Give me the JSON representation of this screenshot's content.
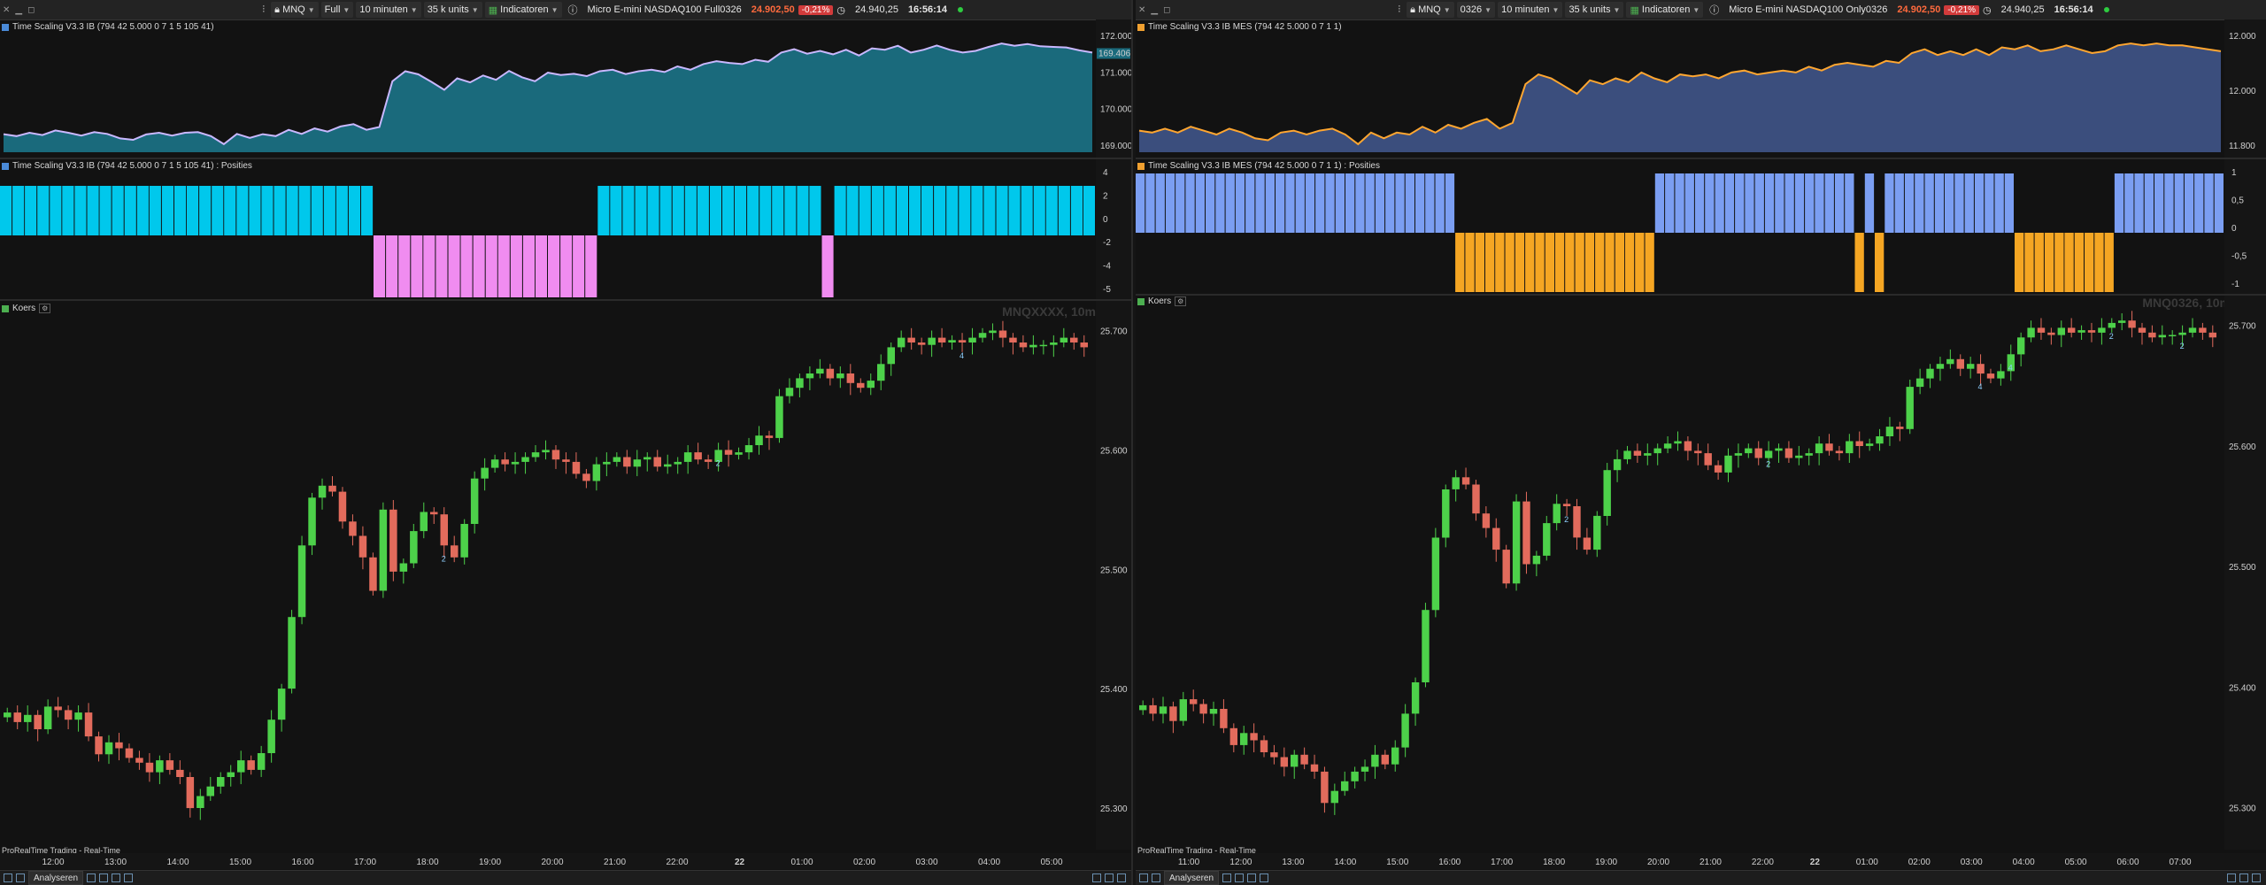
{
  "panels": [
    {
      "toolbar": {
        "symbol": "MNQ",
        "contract": "Full",
        "timeframe": "10 minuten",
        "units": "35 k units",
        "indicators": "Indicatoren",
        "instrument": "Micro E-mini NASDAQ100 Full0326",
        "price": "24.902,50",
        "change": "-0,21%",
        "open_info": "24.940,25",
        "time": "16:56:14"
      },
      "indicator1": {
        "title": "Time Scaling V3.3 IB (794 42 5.000 0 7 1 5 105 41)",
        "fill": "#1a6a7c",
        "line": "#c9b8ff",
        "axis": [
          "172.000",
          "171.000",
          "170.000",
          "169.000"
        ],
        "marker": "169.406",
        "values": [
          169.35,
          169.28,
          169.4,
          169.32,
          169.48,
          169.4,
          169.3,
          169.42,
          169.36,
          169.2,
          169.15,
          169.34,
          169.4,
          169.3,
          169.4,
          169.42,
          169.28,
          169.0,
          169.36,
          169.22,
          169.35,
          169.28,
          169.5,
          169.36,
          169.55,
          169.44,
          169.62,
          169.7,
          169.5,
          169.6,
          171.2,
          171.55,
          171.44,
          171.18,
          170.9,
          171.3,
          171.16,
          171.4,
          171.25,
          171.56,
          171.34,
          171.2,
          171.5,
          171.42,
          171.46,
          171.38,
          171.55,
          171.6,
          171.45,
          171.55,
          171.6,
          171.52,
          171.72,
          171.6,
          171.8,
          171.9,
          171.84,
          171.8,
          171.95,
          171.88,
          172.2,
          172.32,
          172.16,
          172.26,
          172.14,
          172.3,
          172.1,
          172.35,
          172.3,
          172.44,
          172.2,
          172.3,
          172.45,
          172.3,
          172.2,
          172.26,
          172.4,
          172.52,
          172.44,
          172.5,
          172.42,
          172.4,
          172.38,
          172.28,
          172.2
        ]
      },
      "indicator2": {
        "title": "Time Scaling V3.3 IB (794 42 5.000 0 7 1 5 105 41) : Posities",
        "pos_color": "#00c8ec",
        "neg_color": "#f08cf0",
        "axis": [
          "4",
          "2",
          "0",
          "-2",
          "-4",
          "-5"
        ],
        "values": [
          4,
          4,
          4,
          4,
          4,
          4,
          4,
          4,
          4,
          4,
          4,
          4,
          4,
          4,
          4,
          4,
          4,
          4,
          4,
          4,
          4,
          4,
          4,
          4,
          4,
          4,
          4,
          4,
          4,
          4,
          -5,
          -5,
          -5,
          -5,
          -5,
          -5,
          -5,
          -5,
          -5,
          -5,
          -5,
          -5,
          -5,
          -5,
          -5,
          -5,
          -5,
          -5,
          4,
          4,
          4,
          4,
          4,
          4,
          4,
          4,
          4,
          4,
          4,
          4,
          4,
          4,
          4,
          4,
          4,
          4,
          -5,
          4,
          4,
          4,
          4,
          4,
          4,
          4,
          4,
          4,
          4,
          4,
          4,
          4,
          4,
          4,
          4,
          4,
          4,
          4,
          4,
          4
        ]
      },
      "price_chart": {
        "title": "Koers",
        "watermark": "MNQXXXX, 10m",
        "axis": [
          "25.700",
          "25.600",
          "25.500",
          "25.400",
          "25.300"
        ],
        "closes": [
          25380,
          25372,
          25378,
          25366,
          25385,
          25382,
          25374,
          25380,
          25360,
          25345,
          25355,
          25350,
          25342,
          25338,
          25330,
          25340,
          25332,
          25326,
          25300,
          25310,
          25318,
          25326,
          25330,
          25340,
          25332,
          25346,
          25374,
          25400,
          25460,
          25520,
          25560,
          25570,
          25565,
          25540,
          25528,
          25510,
          25482,
          25550,
          25498,
          25505,
          25532,
          25548,
          25546,
          25520,
          25510,
          25538,
          25576,
          25585,
          25592,
          25588,
          25590,
          25594,
          25598,
          25600,
          25592,
          25590,
          25580,
          25574,
          25588,
          25590,
          25594,
          25586,
          25592,
          25594,
          25586,
          25588,
          25590,
          25598,
          25592,
          25590,
          25600,
          25596,
          25598,
          25604,
          25612,
          25610,
          25645,
          25652,
          25660,
          25664,
          25668,
          25660,
          25664,
          25656,
          25652,
          25658,
          25672,
          25686,
          25694,
          25690,
          25688,
          25694,
          25690,
          25692,
          25690,
          25694,
          25698,
          25700,
          25694,
          25690,
          25686,
          25688,
          25688,
          25690,
          25694,
          25690,
          25686
        ],
        "trade_marks": [
          "2",
          "2",
          "4"
        ],
        "x_ticks": [
          "12:00",
          "13:00",
          "14:00",
          "15:00",
          "16:00",
          "17:00",
          "18:00",
          "19:00",
          "20:00",
          "21:00",
          "22:00",
          "22",
          "01:00",
          "02:00",
          "03:00",
          "04:00",
          "05:00"
        ]
      },
      "footer": "ProRealTime Trading - Real-Time",
      "analysis_btn": "Analyseren"
    },
    {
      "toolbar": {
        "symbol": "MNQ",
        "contract": "0326",
        "timeframe": "10 minuten",
        "units": "35 k units",
        "indicators": "Indicatoren",
        "instrument": "Micro E-mini NASDAQ100 Only0326",
        "price": "24.902,50",
        "change": "-0,21%",
        "open_info": "24.940,25",
        "time": "16:56:14"
      },
      "indicator1": {
        "title": "Time Scaling V3.3 IB MES (794 42 5.000 0 7 1 1)",
        "fill": "#3b4e7d",
        "line": "#ffa630",
        "axis": [
          "12.000",
          "12.000",
          "11.800"
        ],
        "marker": "",
        "values": [
          11.82,
          11.8,
          11.84,
          11.8,
          11.86,
          11.82,
          11.78,
          11.84,
          11.8,
          11.74,
          11.72,
          11.8,
          11.82,
          11.78,
          11.82,
          11.84,
          11.78,
          11.68,
          11.8,
          11.74,
          11.8,
          11.78,
          11.86,
          11.8,
          11.88,
          11.84,
          11.9,
          11.94,
          11.84,
          11.9,
          12.3,
          12.4,
          12.36,
          12.28,
          12.2,
          12.34,
          12.3,
          12.36,
          12.32,
          12.42,
          12.36,
          12.32,
          12.4,
          12.38,
          12.4,
          12.36,
          12.42,
          12.44,
          12.4,
          12.42,
          12.44,
          12.42,
          12.48,
          12.44,
          12.5,
          12.52,
          12.5,
          12.48,
          12.54,
          12.52,
          12.62,
          12.66,
          12.6,
          12.64,
          12.6,
          12.66,
          12.6,
          12.68,
          12.66,
          12.7,
          12.64,
          12.66,
          12.7,
          12.66,
          12.62,
          12.64,
          12.7,
          12.72,
          12.7,
          12.72,
          12.7,
          12.7,
          12.68,
          12.66,
          12.64
        ]
      },
      "indicator2": {
        "title": "Time Scaling V3.3 IB MES (794 42 5.000 0 7 1 1) : Posities",
        "pos_color": "#7b9ef2",
        "neg_color": "#f5a623",
        "axis": [
          "1",
          "0,5",
          "0",
          "-0,5",
          "-1"
        ],
        "values": [
          1,
          1,
          1,
          1,
          1,
          1,
          1,
          1,
          1,
          1,
          1,
          1,
          1,
          1,
          1,
          1,
          1,
          1,
          1,
          1,
          1,
          1,
          1,
          1,
          1,
          1,
          1,
          1,
          1,
          1,
          1,
          1,
          -1,
          -1,
          -1,
          -1,
          -1,
          -1,
          -1,
          -1,
          -1,
          -1,
          -1,
          -1,
          -1,
          -1,
          -1,
          -1,
          -1,
          -1,
          -1,
          -1,
          1,
          1,
          1,
          1,
          1,
          1,
          1,
          1,
          1,
          1,
          1,
          1,
          1,
          1,
          1,
          1,
          1,
          1,
          1,
          1,
          -1,
          1,
          -1,
          1,
          1,
          1,
          1,
          1,
          1,
          1,
          1,
          1,
          1,
          1,
          1,
          1,
          -1,
          -1,
          -1,
          -1,
          -1,
          -1,
          -1,
          -1,
          -1,
          -1,
          1,
          1,
          1,
          1,
          1,
          1,
          1,
          1,
          1,
          1,
          1
        ]
      },
      "price_chart": {
        "title": "Koers",
        "watermark": "MNQ0326, 10m",
        "axis": [
          "25.700",
          "25.600",
          "25.500",
          "25.400",
          "25.300"
        ],
        "closes": [
          25385,
          25378,
          25384,
          25372,
          25390,
          25386,
          25378,
          25382,
          25366,
          25352,
          25362,
          25356,
          25346,
          25342,
          25334,
          25344,
          25336,
          25330,
          25304,
          25314,
          25322,
          25330,
          25334,
          25344,
          25336,
          25350,
          25378,
          25404,
          25464,
          25524,
          25564,
          25574,
          25568,
          25544,
          25532,
          25514,
          25486,
          25554,
          25502,
          25509,
          25536,
          25552,
          25550,
          25524,
          25514,
          25542,
          25580,
          25589,
          25596,
          25592,
          25594,
          25598,
          25602,
          25604,
          25596,
          25594,
          25584,
          25578,
          25592,
          25594,
          25598,
          25590,
          25596,
          25598,
          25590,
          25592,
          25594,
          25602,
          25596,
          25594,
          25604,
          25600,
          25602,
          25608,
          25616,
          25614,
          25649,
          25656,
          25664,
          25668,
          25672,
          25664,
          25668,
          25660,
          25656,
          25662,
          25676,
          25690,
          25698,
          25694,
          25692,
          25698,
          25694,
          25696,
          25694,
          25698,
          25702,
          25704,
          25698,
          25694,
          25690,
          25692,
          25692,
          25694,
          25698,
          25694,
          25690
        ],
        "trade_marks": [
          "2",
          "2",
          "4",
          "4",
          "2",
          "2"
        ],
        "x_ticks": [
          "11:00",
          "12:00",
          "13:00",
          "14:00",
          "15:00",
          "16:00",
          "17:00",
          "18:00",
          "19:00",
          "20:00",
          "21:00",
          "22:00",
          "22",
          "01:00",
          "02:00",
          "03:00",
          "04:00",
          "05:00",
          "06:00",
          "07:00"
        ]
      },
      "footer": "ProRealTime Trading - Real-Time",
      "analysis_btn": "Analyseren"
    }
  ]
}
